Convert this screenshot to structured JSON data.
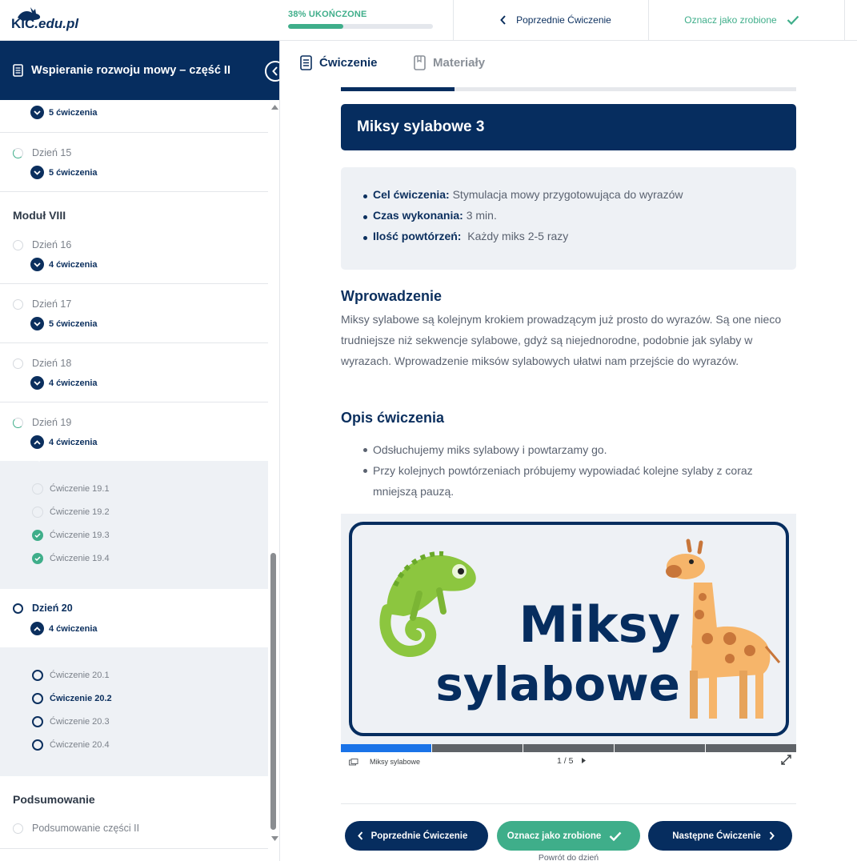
{
  "logo": {
    "main": "KIC",
    "suffix": ".edu.pl"
  },
  "progress": {
    "label": "38% UKOŃCZONE",
    "fraction": 0.38
  },
  "topnav": {
    "prev_label": "Poprzednie Ćwiczenie",
    "done_label": "Oznacz jako zrobione"
  },
  "sidebar": {
    "course_title": "Wspieranie rozwoju mowy – część II",
    "top_count": "5 ćwiczenia",
    "day15": {
      "label": "Dzień 15",
      "count": "5 ćwiczenia"
    },
    "module8": "Moduł VIII",
    "day16": {
      "label": "Dzień 16",
      "count": "4 ćwiczenia"
    },
    "day17": {
      "label": "Dzień 17",
      "count": "5 ćwiczenia"
    },
    "day18": {
      "label": "Dzień 18",
      "count": "4 ćwiczenia"
    },
    "day19": {
      "label": "Dzień 19",
      "count": "4 ćwiczenia",
      "items": [
        "Ćwiczenie 19.1",
        "Ćwiczenie 19.2",
        "Ćwiczenie 19.3",
        "Ćwiczenie 19.4"
      ]
    },
    "day20": {
      "label": "Dzień 20",
      "count": "4 ćwiczenia",
      "items": [
        "Ćwiczenie 20.1",
        "Ćwiczenie 20.2",
        "Ćwiczenie 20.3",
        "Ćwiczenie 20.4"
      ]
    },
    "summary_module": "Podsumowanie",
    "summary_item": "Podsumowanie części II"
  },
  "tabs": {
    "exercise": "Ćwiczenie",
    "materials": "Materiały"
  },
  "exercise": {
    "title": "Miksy sylabowe 3",
    "info": {
      "goal_label": "Cel ćwiczenia:",
      "goal_value": " Stymulacja mowy przygotowująca do wyrazów",
      "time_label": "Czas wykonania:",
      "time_value": " 3 min.",
      "reps_label": "Ilość powtórzeń:",
      "reps_value": "  Każdy miks 2-5 razy"
    },
    "intro_heading": "Wprowadzenie",
    "intro_text": "Miksy sylabowe są kolejnym krokiem prowadzącym już prosto do wyrazów. Są one nieco trudniejsze niż sekwencje sylabowe, gdyż są niejednorodne, podobnie jak sylaby w wyrazach. Wprowadzenie miksów sylabowych ułatwi nam przejście do wyrazów.",
    "desc_heading": "Opis ćwiczenia",
    "desc_items": [
      "Odsłuchujemy miks sylabowy i powtarzamy go.",
      "Przy kolejnych powtórzeniach próbujemy wypowiadać kolejne sylaby z coraz mniejszą pauzą."
    ]
  },
  "viewer": {
    "slide_line1": "Miksy",
    "slide_line2": "sylabowe",
    "deck_title": "Miksy sylabowe",
    "page": "1 / 5",
    "current": 1,
    "total": 5
  },
  "footer": {
    "prev_label": "Poprzednie Ćwiczenie",
    "done_label": "Oznacz jako zrobione",
    "next_label": "Następne Ćwiczenie",
    "back_label": "Powrót do dzień"
  },
  "colors": {
    "navy": "#062d5f",
    "green": "#3fae8a",
    "panel": "#eef1f5"
  }
}
